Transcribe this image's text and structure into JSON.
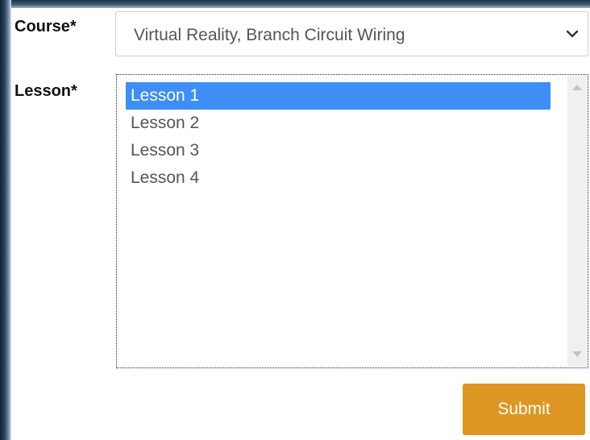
{
  "form": {
    "course_label": "Course*",
    "course_selected": "Virtual Reality, Branch Circuit Wiring",
    "lesson_label": "Lesson*",
    "lessons": [
      {
        "label": "Lesson 1",
        "selected": true
      },
      {
        "label": "Lesson 2",
        "selected": false
      },
      {
        "label": "Lesson 3",
        "selected": false
      },
      {
        "label": "Lesson 4",
        "selected": false
      }
    ],
    "submit_label": "Submit"
  },
  "colors": {
    "accent": "#dd9621",
    "selection": "#3d8ef7"
  },
  "icons": {
    "select_arrow": "chevron-down-icon",
    "scroll_up": "scroll-up-arrow-icon",
    "scroll_down": "scroll-down-arrow-icon"
  }
}
